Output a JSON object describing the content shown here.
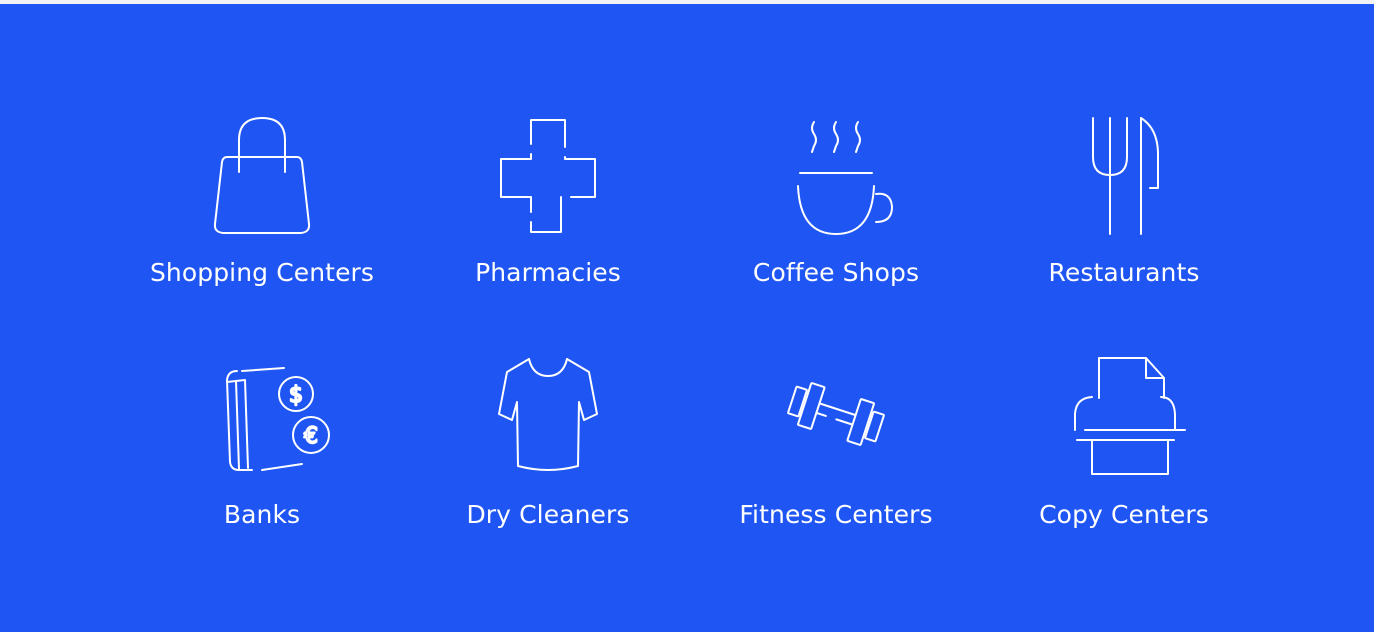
{
  "amenities": [
    {
      "label": "Shopping Centers",
      "icon": "shopping-bag-icon"
    },
    {
      "label": "Pharmacies",
      "icon": "medical-cross-icon"
    },
    {
      "label": "Coffee Shops",
      "icon": "coffee-cup-icon"
    },
    {
      "label": "Restaurants",
      "icon": "fork-knife-icon"
    },
    {
      "label": "Banks",
      "icon": "credit-card-currency-icon"
    },
    {
      "label": "Dry Cleaners",
      "icon": "t-shirt-icon"
    },
    {
      "label": "Fitness Centers",
      "icon": "dumbbell-icon"
    },
    {
      "label": "Copy Centers",
      "icon": "printer-icon"
    }
  ],
  "colors": {
    "background": "#1f56f3",
    "foreground": "#ffffff"
  }
}
